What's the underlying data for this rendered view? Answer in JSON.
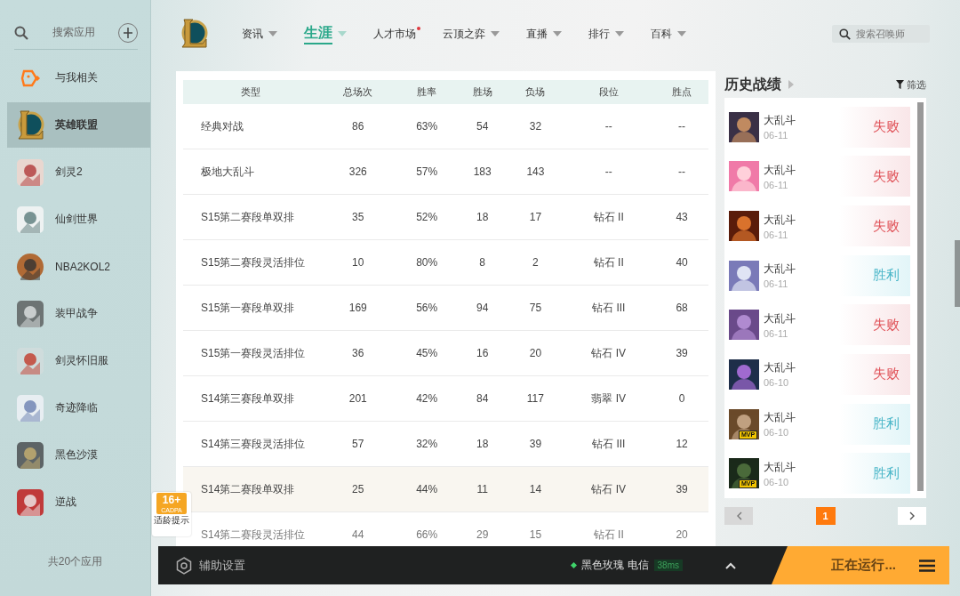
{
  "sidebar": {
    "search_placeholder": "搜索应用",
    "items": [
      {
        "label": "与我相关",
        "selected": false
      },
      {
        "label": "英雄联盟",
        "selected": true
      },
      {
        "label": "剑灵2",
        "selected": false
      },
      {
        "label": "仙剑世界",
        "selected": false
      },
      {
        "label": "NBA2KOL2",
        "selected": false
      },
      {
        "label": "装甲战争",
        "selected": false
      },
      {
        "label": "剑灵怀旧服",
        "selected": false
      },
      {
        "label": "奇迹降临",
        "selected": false
      },
      {
        "label": "黑色沙漠",
        "selected": false
      },
      {
        "label": "逆战",
        "selected": false
      }
    ],
    "footer": "共20个应用"
  },
  "nav": {
    "tabs": [
      {
        "label": "资讯",
        "selected": false,
        "dropdown": true,
        "dot": false
      },
      {
        "label": "生涯",
        "selected": true,
        "dropdown": true,
        "dot": false
      },
      {
        "label": "人才市场",
        "selected": false,
        "dropdown": false,
        "dot": true
      },
      {
        "label": "云顶之弈",
        "selected": false,
        "dropdown": true,
        "dot": false
      },
      {
        "label": "直播",
        "selected": false,
        "dropdown": true,
        "dot": false
      },
      {
        "label": "排行",
        "selected": false,
        "dropdown": true,
        "dot": false
      },
      {
        "label": "百科",
        "selected": false,
        "dropdown": true,
        "dot": false
      }
    ],
    "search_placeholder": "搜索召唤师"
  },
  "career_table": {
    "columns": [
      "类型",
      "总场次",
      "胜率",
      "胜场",
      "负场",
      "段位",
      "胜点"
    ],
    "rows": [
      {
        "cells": [
          "经典对战",
          "86",
          "63%",
          "54",
          "32",
          "--",
          "--"
        ],
        "selected": false
      },
      {
        "cells": [
          "极地大乱斗",
          "326",
          "57%",
          "183",
          "143",
          "--",
          "--"
        ],
        "selected": false
      },
      {
        "cells": [
          "S15第二赛段单双排",
          "35",
          "52%",
          "18",
          "17",
          "钻石 II",
          "43"
        ],
        "selected": false
      },
      {
        "cells": [
          "S15第二赛段灵活排位",
          "10",
          "80%",
          "8",
          "2",
          "钻石 II",
          "40"
        ],
        "selected": false
      },
      {
        "cells": [
          "S15第一赛段单双排",
          "169",
          "56%",
          "94",
          "75",
          "钻石 III",
          "68"
        ],
        "selected": false
      },
      {
        "cells": [
          "S15第一赛段灵活排位",
          "36",
          "45%",
          "16",
          "20",
          "钻石 IV",
          "39"
        ],
        "selected": false
      },
      {
        "cells": [
          "S14第三赛段单双排",
          "201",
          "42%",
          "84",
          "117",
          "翡翠 IV",
          "0"
        ],
        "selected": false
      },
      {
        "cells": [
          "S14第三赛段灵活排位",
          "57",
          "32%",
          "18",
          "39",
          "钻石 III",
          "12"
        ],
        "selected": false
      },
      {
        "cells": [
          "S14第二赛段单双排",
          "25",
          "44%",
          "11",
          "14",
          "钻石 IV",
          "39"
        ],
        "selected": true
      },
      {
        "cells": [
          "S14第二赛段灵活排位",
          "44",
          "66%",
          "29",
          "15",
          "钻石 II",
          "20"
        ],
        "selected": false
      }
    ]
  },
  "match_history": {
    "title": "历史战绩",
    "filter": "筛选",
    "matches": [
      {
        "mode": "大乱斗",
        "date": "06-11",
        "result": "失败",
        "kind": "loss"
      },
      {
        "mode": "大乱斗",
        "date": "06-11",
        "result": "失败",
        "kind": "loss"
      },
      {
        "mode": "大乱斗",
        "date": "06-11",
        "result": "失败",
        "kind": "loss"
      },
      {
        "mode": "大乱斗",
        "date": "06-11",
        "result": "胜利",
        "kind": "win"
      },
      {
        "mode": "大乱斗",
        "date": "06-11",
        "result": "失败",
        "kind": "loss"
      },
      {
        "mode": "大乱斗",
        "date": "06-10",
        "result": "失败",
        "kind": "loss"
      },
      {
        "mode": "大乱斗",
        "date": "06-10",
        "result": "胜利",
        "kind": "win",
        "badge": "MVP"
      },
      {
        "mode": "大乱斗",
        "date": "06-10",
        "result": "胜利",
        "kind": "win",
        "badge": "MVP"
      }
    ],
    "pages": [
      {
        "label": "1",
        "selected": true
      }
    ]
  },
  "age_badge": {
    "rating": "16+",
    "org": "CADPA",
    "caption": "适龄提示"
  },
  "bottom_bar": {
    "assist": "辅助设置",
    "server": "黑色玫瑰 电信",
    "ping": "38ms",
    "status": "正在运行..."
  }
}
